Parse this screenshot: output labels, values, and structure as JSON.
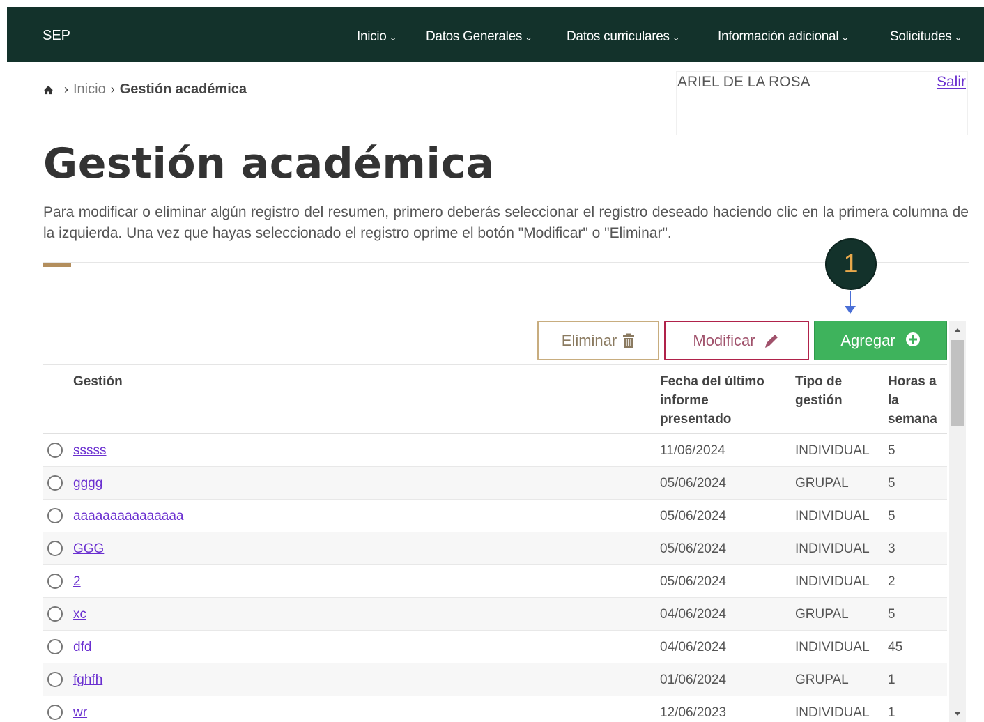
{
  "navbar": {
    "brand": "SEP",
    "items": [
      {
        "label": "Inicio",
        "caret": "⌄"
      },
      {
        "label": "Datos Generales",
        "caret": "⌄"
      },
      {
        "label": "Datos curriculares",
        "caret": "⌄"
      },
      {
        "label": "Información adicional",
        "caret": "⌄"
      },
      {
        "label": "Solicitudes",
        "caret": "⌄"
      }
    ],
    "background_color": "#13322b"
  },
  "breadcrumb": {
    "home_icon": "home-icon",
    "separator": "›",
    "items": [
      "Inicio",
      "Gestión académica"
    ]
  },
  "user": {
    "name": "ARIEL DE LA ROSA",
    "logout_label": "Salir"
  },
  "page": {
    "title": "Gestión académica",
    "intro": "Para modificar o eliminar algún registro del resumen, primero deberás seleccionar el registro deseado haciendo clic en la primera columna de la izquierda. Una vez que hayas seleccionado el registro oprime el botón \"Modificar\" o \"Eliminar\"."
  },
  "annotation": {
    "step_number": "1"
  },
  "toolbar": {
    "delete_label": "Eliminar",
    "delete_icon": "trash-icon",
    "edit_label": "Modificar",
    "edit_icon": "pencil-icon",
    "add_label": "Agregar",
    "add_icon": "plus-circle-icon",
    "colors": {
      "delete_border": "#c8ad7f",
      "edit_border": "#b0224a",
      "add_bg": "#3eb35c"
    }
  },
  "table": {
    "headers": {
      "gestion": "Gestión",
      "fecha_l1": "Fecha del último",
      "fecha_l2": "informe",
      "fecha_l3": "presentado",
      "tipo_l1": "Tipo de",
      "tipo_l2": "gestión",
      "horas_l1": "Horas a",
      "horas_l2": "la",
      "horas_l3": "semana"
    },
    "rows": [
      {
        "gestion": "sssss",
        "fecha": "11/06/2024",
        "tipo": "INDIVIDUAL",
        "horas": "5"
      },
      {
        "gestion": "gggg",
        "fecha": "05/06/2024",
        "tipo": "GRUPAL",
        "horas": "5"
      },
      {
        "gestion": "aaaaaaaaaaaaaaa",
        "fecha": "05/06/2024",
        "tipo": "INDIVIDUAL",
        "horas": "5"
      },
      {
        "gestion": "GGG",
        "fecha": "05/06/2024",
        "tipo": "INDIVIDUAL",
        "horas": "3"
      },
      {
        "gestion": "2",
        "fecha": "05/06/2024",
        "tipo": "INDIVIDUAL",
        "horas": "2"
      },
      {
        "gestion": "xc",
        "fecha": "04/06/2024",
        "tipo": "GRUPAL",
        "horas": "5"
      },
      {
        "gestion": "dfd",
        "fecha": "04/06/2024",
        "tipo": "INDIVIDUAL",
        "horas": "45"
      },
      {
        "gestion": "fghfh",
        "fecha": "01/06/2024",
        "tipo": "GRUPAL",
        "horas": "1"
      },
      {
        "gestion": "wr",
        "fecha": "12/06/2023",
        "tipo": "INDIVIDUAL",
        "horas": "1"
      }
    ]
  }
}
